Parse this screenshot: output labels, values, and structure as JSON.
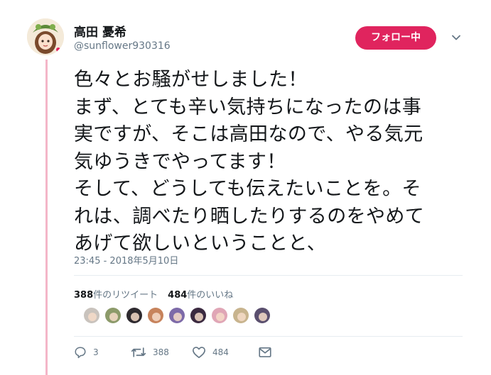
{
  "tweet": {
    "display_name": "高田 憂希",
    "handle": "@sunflower930316",
    "follow_label": "フォロー中",
    "text_lines": [
      "色々とお騒がせしました！",
      "まず、とても辛い気持ちになったのは事",
      "実ですが、そこは高田なので、やる気元",
      "気ゆうきでやってます！",
      "そして、どうしても伝えたいことを。そ",
      "れは、調べたり晒したりするのをやめて",
      "あげて欲しいということと、"
    ],
    "timestamp": "23:45 - 2018年5月10日"
  },
  "stats": {
    "retweets_count": "388",
    "retweets_label": "件のリツイート",
    "likes_count": "484",
    "likes_label": "件のいいね"
  },
  "likers": [
    {
      "icon": "avatar-1",
      "color": "#c9c3bd"
    },
    {
      "icon": "avatar-2",
      "color": "#8c9a6a"
    },
    {
      "icon": "avatar-3",
      "color": "#2e2a2f"
    },
    {
      "icon": "avatar-4",
      "color": "#c7835c"
    },
    {
      "icon": "avatar-5",
      "color": "#7d6aa8"
    },
    {
      "icon": "avatar-6",
      "color": "#3b2a40"
    },
    {
      "icon": "avatar-7",
      "color": "#e0a6b6"
    },
    {
      "icon": "avatar-8",
      "color": "#c8b48e"
    },
    {
      "icon": "avatar-9",
      "color": "#5a4f6e"
    }
  ],
  "actions": {
    "reply_count": "3",
    "retweet_count": "388",
    "like_count": "484"
  },
  "colors": {
    "accent": "#e0245e",
    "thread_line": "#f4b6c8",
    "muted_text": "#657786"
  }
}
